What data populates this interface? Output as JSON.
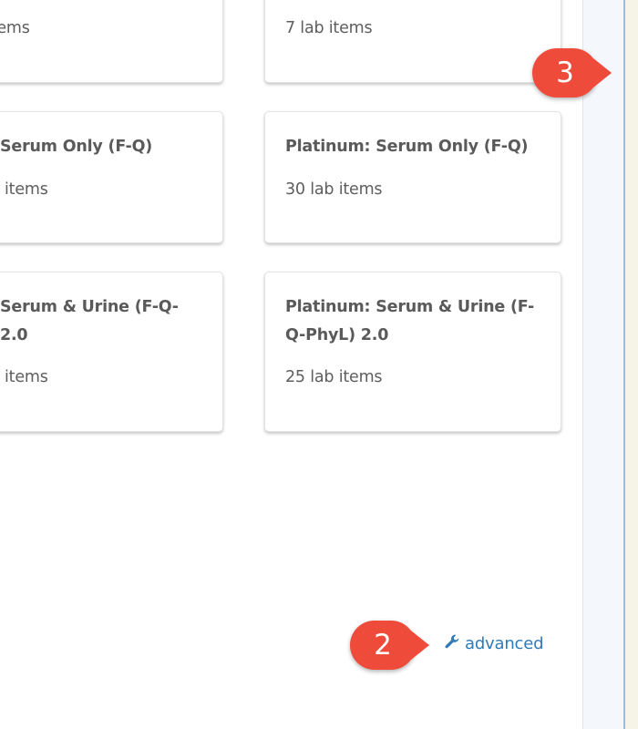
{
  "cards": [
    {
      "title": "",
      "subtitle": "items"
    },
    {
      "title": "",
      "subtitle": "7 lab items"
    },
    {
      "title": "Serum Only (F-Q)",
      "subtitle": "items"
    },
    {
      "title": "Platinum: Serum Only (F-Q)",
      "subtitle": "30 lab items"
    },
    {
      "title_line1": "Serum & Urine (F-Q-",
      "title_line2": "2.0",
      "subtitle": "items"
    },
    {
      "title_line1": "Platinum: Serum & Urine (F-",
      "title_line2": "Q-PhyL) 2.0",
      "subtitle": "25 lab items"
    }
  ],
  "badges": {
    "step2": "2",
    "step3": "3"
  },
  "advanced_link": {
    "label": "advanced",
    "icon": "wrench-icon"
  },
  "colors": {
    "badge": "#ee4b3b",
    "link": "#2f7ab8"
  }
}
